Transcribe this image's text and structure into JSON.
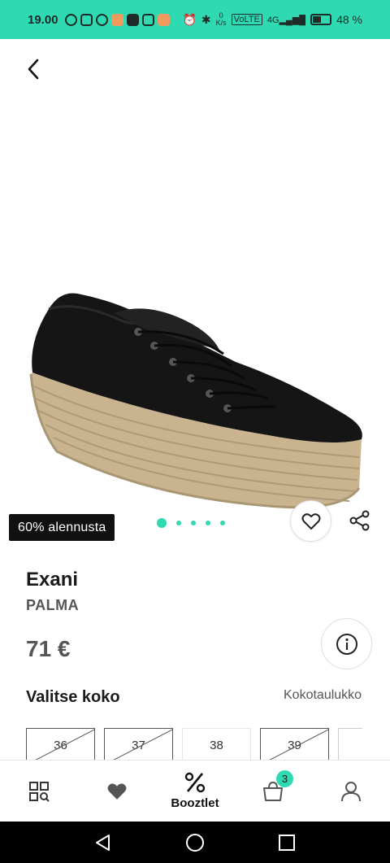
{
  "status_bar": {
    "time": "19.00",
    "net_speed_value": "0",
    "net_speed_unit": "K/s",
    "battery": "48 %",
    "accent_color": "#2fd9b2"
  },
  "product": {
    "discount_badge": "60% alennusta",
    "brand": "Exani",
    "model": "PALMA",
    "price": "71 €",
    "image_count": 5,
    "active_image": 1
  },
  "size_section": {
    "title": "Valitse koko",
    "chart_link": "Kokotaulukko",
    "sizes": [
      {
        "label": "36",
        "available": false
      },
      {
        "label": "37",
        "available": false
      },
      {
        "label": "38",
        "available": true
      },
      {
        "label": "39",
        "available": false
      }
    ]
  },
  "tab_bar": {
    "tabs": [
      {
        "icon": "grid-search-icon",
        "label": ""
      },
      {
        "icon": "heart-icon",
        "label": ""
      },
      {
        "icon": "percent-icon",
        "label": "Booztlet"
      },
      {
        "icon": "bag-icon",
        "label": "",
        "badge": "3"
      },
      {
        "icon": "user-icon",
        "label": ""
      }
    ]
  },
  "system_nav": [
    "back-icon",
    "home-icon",
    "recents-icon"
  ]
}
